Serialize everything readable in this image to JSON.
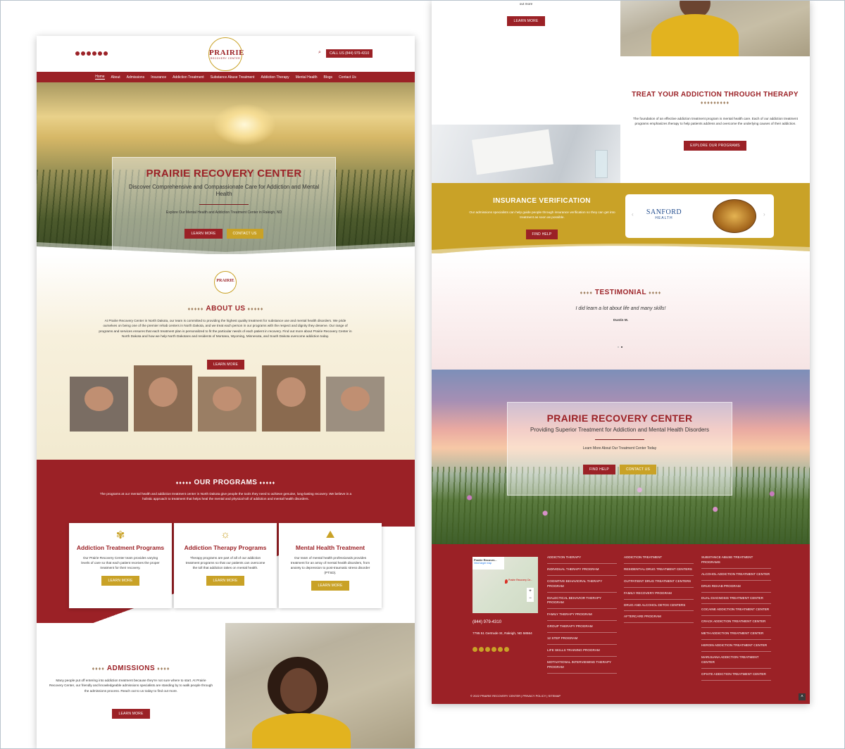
{
  "header": {
    "logo_main": "PRAIRIE",
    "logo_sub": "RECOVERY CENTER",
    "call_button": "CALL US (844) 979-4310"
  },
  "nav": {
    "items": [
      "Home",
      "About",
      "Admissions",
      "Insurance",
      "Addiction Treatment",
      "Substance Abuse Treatment",
      "Addiction Therapy",
      "Mental Health",
      "Blogs",
      "Contact Us"
    ]
  },
  "hero": {
    "title": "PRAIRIE RECOVERY CENTER",
    "subtitle": "Discover Comprehensive and Compassionate Care for Addiction and Mental Health",
    "tagline": "Explore Our Mental Health and Addiction Treatment Center in Raleigh, ND",
    "learn_more": "LEARN MORE",
    "contact_us": "CONTACT US"
  },
  "about": {
    "heading": "ABOUT US",
    "body": "At Prairie Recovery Center in North Dakota, our team is committed to providing the highest quality treatment for substance use and mental health disorders. We pride ourselves on being one of the premier rehab centers in North Dakota, and we treat each person in our programs with the respect and dignity they deserve. Our range of programs and services ensures that each treatment plan is personalized to fit the particular needs of each patient in recovery. Find out more about Prairie Recovery Center in North Dakota and how we help North Dakotans and residents of Montana, Wyoming, Minnesota, and South Dakota overcome addiction today.",
    "button": "LEARN MORE"
  },
  "programs": {
    "heading": "OUR PROGRAMS",
    "intro": "The programs at our mental health and addiction treatment center in North Dakota give people the tools they need to achieve genuine, long-lasting recovery. We believe in a holistic approach to treatment that helps heal the mental and physical toll of addiction and mental health disorders.",
    "cards": [
      {
        "title": "Addiction Treatment Programs",
        "body": "Our Prairie Recovery Center team provides varying levels of care so that each patient receives the proper treatment for their recovery.",
        "button": "LEARN MORE"
      },
      {
        "title": "Addiction Therapy Programs",
        "body": "Therapy programs are part of all of our addiction treatment programs so that our patients can overcome the toll that addiction takes on mental health.",
        "button": "LEARN MORE"
      },
      {
        "title": "Mental Health Treatment",
        "body": "Our team of mental health professionals provides treatment for an array of mental health disorders, from anxiety to depression to post-traumatic stress disorder (PTSD).",
        "button": "LEARN MORE"
      }
    ]
  },
  "admissions": {
    "heading": "ADMISSIONS",
    "body": "Many people put off entering into addiction treatment because they're not sure where to start. At Prairie Recovery Center, our friendly and knowledgeable admissions specialists are standing by to walk people through the admissions process. Reach out to us today to find out more.",
    "top_fragment": "out more",
    "button": "LEARN MORE"
  },
  "therapy": {
    "heading": "TREAT YOUR ADDICTION THROUGH THERAPY",
    "body": "The foundation of an effective addiction treatment program is mental health care. Each of our addiction treatment programs emphasizes therapy to help patients address and overcome the underlying causes of their addiction.",
    "button": "EXPLORE OUR PROGRAMS"
  },
  "insurance": {
    "heading": "INSURANCE VERIFICATION",
    "body": "Our admissions specialists can help guide people through insurance verification so they can get into treatment as soon as possible.",
    "button": "FIND HELP",
    "logo_main": "SANFORD",
    "logo_sub": "HEALTH"
  },
  "testimonial": {
    "heading": "TESTIMONIAL",
    "quote": "I did learn a lot about life and many skills!",
    "author": "Dustin M."
  },
  "cta": {
    "title": "PRAIRIE RECOVERY CENTER",
    "subtitle": "Providing Superior Treatment for Addiction and Mental Health Disorders",
    "tagline": "Learn More About Our Treatment Center Today",
    "find_help": "FIND HELP",
    "contact_us": "CONTACT US"
  },
  "footer": {
    "map_label": "Prairie Recover...",
    "map_link": "View larger map",
    "map_pin": "Prairie Recovery Ce...",
    "phone": "(844) 979-4310",
    "address": "7795 51 Gertrude St, Raleigh, ND 58564",
    "col1": [
      "ADDICTION THERAPY",
      "INDIVIDUAL THERAPY PROGRAM",
      "COGNITIVE BEHAVIORAL THERAPY PROGRAM",
      "DIALECTICAL BEHAVIOR THERAPY PROGRAM",
      "FAMILY THERAPY PROGRAM",
      "GROUP THERAPY PROGRAM",
      "12 STEP PROGRAM",
      "LIFE SKILLS TRAINING PROGRAM",
      "MOTIVATIONAL INTERVIEWING THERAPY PROGRAM"
    ],
    "col2": [
      "ADDICTION TREATMENT",
      "RESIDENTIAL DRUG TREATMENT CENTERS",
      "OUTPATIENT DRUG TREATMENT CENTERS",
      "FAMILY RECOVERY PROGRAM",
      "DRUG AND ALCOHOL DETOX CENTERS",
      "AFTERCARE PROGRAM"
    ],
    "col3": [
      "SUBSTANCE ABUSE TREATMENT PROGRAMS",
      "ALCOHOL ADDICTION TREATMENT CENTER",
      "DRUG REHAB PROGRAM",
      "DUAL DIAGNOSIS TREATMENT CENTER",
      "COCAINE ADDICTION TREATMENT CENTER",
      "CRACK ADDICTION TREATMENT CENTER",
      "METH ADDICTION TREATMENT CENTER",
      "HEROIN ADDICTION TREATMENT CENTER",
      "MARIJUANA ADDICTION TREATMENT CENTER",
      "OPIATE ADDICTION TREATMENT CENTER"
    ],
    "copyright": "© 2022 PRAIRIE RECOVERY CENTER | PRIVACY POLICY | SITEMAP"
  },
  "colors": {
    "brand_red": "#9b2126",
    "brand_gold": "#c9a227"
  },
  "icons": [
    "facebook-icon",
    "instagram-icon",
    "twitter-icon",
    "pinterest-icon",
    "youtube-icon",
    "search-icon",
    "wheat-icon",
    "sun-icon",
    "mountain-icon",
    "chevron-left-icon",
    "chevron-right-icon",
    "back-to-top-icon"
  ]
}
